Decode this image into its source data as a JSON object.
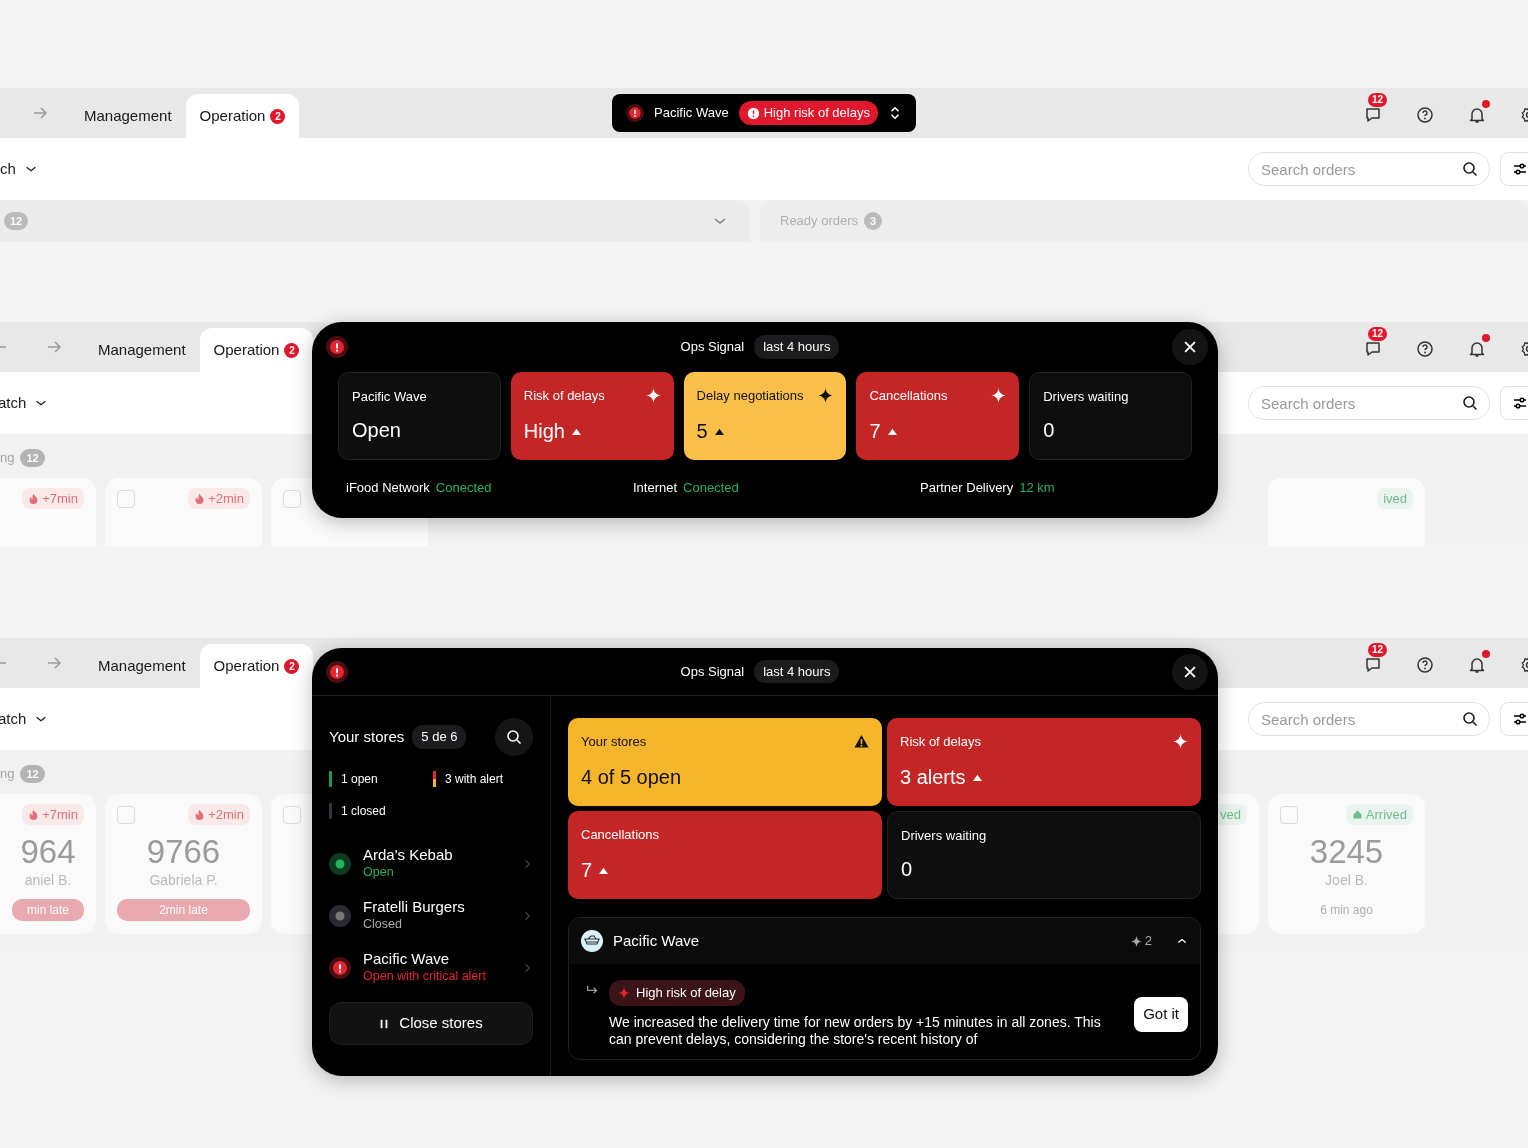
{
  "sections": [
    {
      "tabs": [
        {
          "label": "Management",
          "selected": false
        },
        {
          "label": "Operation",
          "badge": "2",
          "selected": true
        }
      ],
      "store_pill": {
        "store": "Pacific Wave",
        "alert": "High risk of delays"
      },
      "messages_badge": "12",
      "notifications_unread": true,
      "filter_label": "ch",
      "search": {
        "placeholder": "Search orders"
      },
      "board": {
        "count": "12",
        "ready_label": "Ready orders",
        "ready_count": "3"
      }
    },
    {
      "tabs": [
        {
          "label": "Management",
          "selected": false
        },
        {
          "label": "Operation",
          "badge": "2",
          "selected": true
        }
      ],
      "messages_badge": "12",
      "notifications_unread": true,
      "filter_label": "atch",
      "search": {
        "placeholder": "Search orders"
      },
      "board": {
        "label": "ng",
        "count": "12",
        "cards_start": [
          {
            "delay": "+7min"
          },
          {
            "delay": "+2min",
            "checked": false
          },
          {
            "checked": false
          }
        ],
        "cards_end": [
          {
            "status": "ived"
          }
        ]
      },
      "ops_signal": {
        "title": "Ops Signal",
        "period": "last 4 hours",
        "tiles": [
          {
            "label": "Pacific Wave",
            "value": "Open",
            "kind": "neutral",
            "trend_up": false
          },
          {
            "label": "Risk of delays",
            "value": "High",
            "kind": "risk",
            "trend_up": true
          },
          {
            "label": "Delay negotiations",
            "value": "5",
            "kind": "caution",
            "trend_up": true
          },
          {
            "label": "Cancellations",
            "value": "7",
            "kind": "risk",
            "trend_up": true
          },
          {
            "label": "Drivers waiting",
            "value": "0",
            "kind": "neutral",
            "trend_up": false
          }
        ],
        "connections": [
          {
            "label": "iFood Network",
            "value": "Conected"
          },
          {
            "label": "Internet",
            "value": "Conected"
          },
          {
            "label": "Partner Delivery",
            "value": "12 km"
          }
        ]
      }
    },
    {
      "tabs": [
        {
          "label": "Management",
          "selected": false
        },
        {
          "label": "Operation",
          "badge": "2",
          "selected": true
        }
      ],
      "messages_badge": "12",
      "notifications_unread": true,
      "filter_label": "atch",
      "search": {
        "placeholder": "Search orders"
      },
      "board": {
        "label": "ng",
        "count": "12",
        "cards_start": [
          {
            "delay": "+7min",
            "number": "964",
            "customer": "aniel B.",
            "late": "min late"
          },
          {
            "delay": "+2min",
            "checked": false,
            "number": "9766",
            "customer": "Gabriela P.",
            "late": "2min late"
          },
          {
            "checked": false
          }
        ],
        "cards_end": [
          {
            "status": "ved"
          },
          {
            "checked": false,
            "status": "Arrived",
            "number": "3245",
            "customer": "Joel B.",
            "time": "6 min ago"
          }
        ]
      },
      "ops_signal": {
        "title": "Ops Signal",
        "period": "last 4 hours",
        "stores": {
          "title": "Your stores",
          "count": "5 de 6",
          "summary": [
            {
              "label": "1 open",
              "kind": "open"
            },
            {
              "label": "3 with alert",
              "kind": "alert"
            },
            {
              "label": "1 closed",
              "kind": "closed"
            }
          ],
          "list": [
            {
              "name": "Arda's Kebab",
              "status": "Open",
              "kind": "open"
            },
            {
              "name": "Fratelli Burgers",
              "status": "Closed",
              "kind": "closed"
            },
            {
              "name": "Pacific Wave",
              "status": "Open with critical alert",
              "kind": "critical"
            }
          ],
          "action": "Close stores"
        },
        "tiles": [
          {
            "label": "Your stores",
            "value": "4 of 5 open",
            "kind": "warning",
            "trend_up": false
          },
          {
            "label": "Risk of delays",
            "value": "3 alerts",
            "kind": "risk",
            "trend_up": true
          },
          {
            "label": "Cancellations",
            "value": "7",
            "kind": "alarm",
            "trend_up": true
          },
          {
            "label": "Drivers waiting",
            "value": "0",
            "kind": "neutral",
            "trend_up": false
          }
        ],
        "store_alert": {
          "name": "Pacific Wave",
          "count": "2",
          "expanded": true,
          "alerts": [
            {
              "label": "High risk of delay",
              "message": "We increased the delivery time for new orders by +15 minutes in all zones. This can prevent delays, considering the store's recent history of",
              "action": "Got it"
            }
          ]
        }
      }
    }
  ]
}
